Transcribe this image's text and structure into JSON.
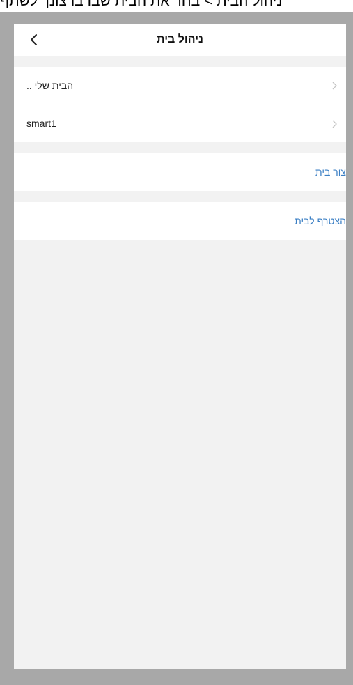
{
  "caption": "ניהול הבית > בחר את הבית שבו ברצונך לשתף",
  "header": {
    "title": "ניהול בית"
  },
  "homes": [
    {
      "label": "הבית שלי .."
    },
    {
      "label": "smart1"
    }
  ],
  "actions": {
    "create_home": "צור בית",
    "join_home": "הצטרף לבית"
  },
  "colors": {
    "accent": "#3b7fc4",
    "background": "#f2f2f2",
    "frame": "#a8a8a8"
  },
  "icons": {
    "back": "chevron-left-icon",
    "row_arrow": "chevron-right-icon"
  }
}
